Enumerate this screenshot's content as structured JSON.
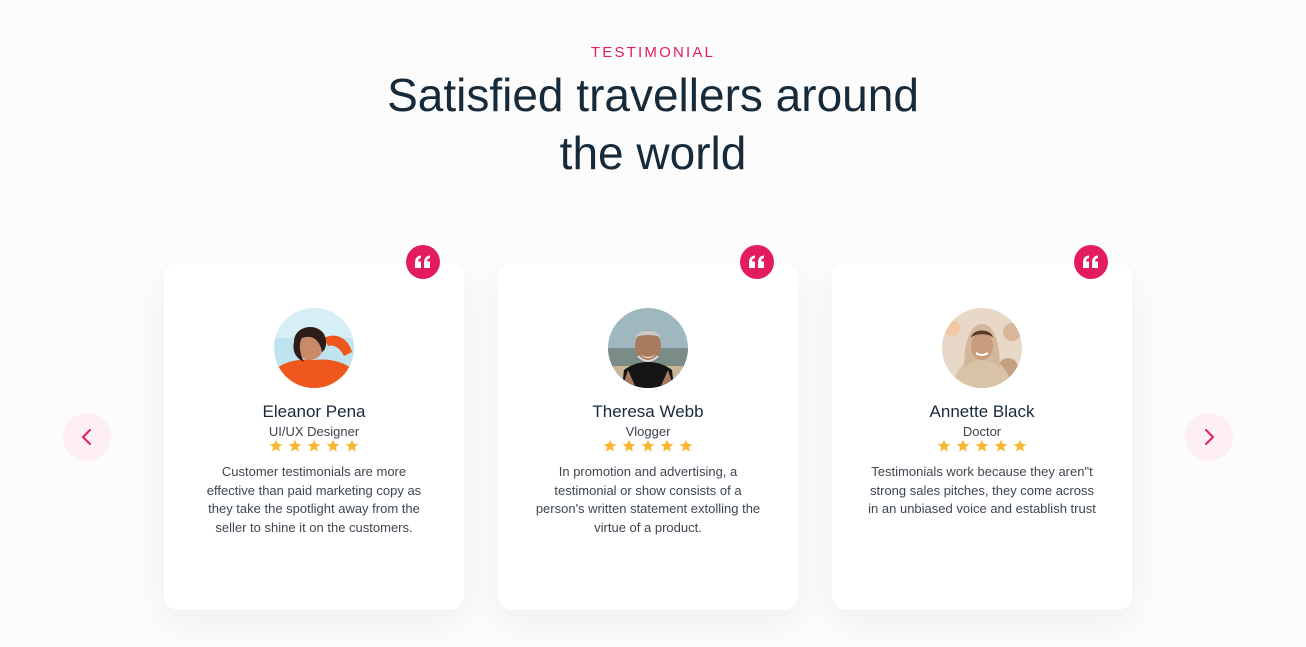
{
  "section": {
    "eyebrow": "TESTIMONIAL",
    "heading_line1": "Satisfied travellers around",
    "heading_line2": "the world"
  },
  "colors": {
    "accent": "#e31c5f",
    "heading": "#172a3a",
    "star": "#f7b731",
    "arrow_bg": "#fdeff3"
  },
  "navigation": {
    "prev_icon": "chevron-left-icon",
    "next_icon": "chevron-right-icon"
  },
  "testimonials": [
    {
      "name": "Eleanor Pena",
      "role": "UI/UX Designer",
      "rating": 5,
      "text": "Customer testimonials are more effective than paid marketing copy as they take the spotlight away from the seller to shine it on the customers.",
      "quote_icon": "quote-icon"
    },
    {
      "name": "Theresa Webb",
      "role": "Vlogger",
      "rating": 5,
      "text": "In promotion and advertising, a testimonial or show consists of a person's written statement extolling the virtue of a product.",
      "quote_icon": "quote-icon"
    },
    {
      "name": "Annette Black",
      "role": "Doctor",
      "rating": 5,
      "text": "Testimonials work because they aren\"t strong sales pitches, they come across in an unbiased voice and establish trust",
      "quote_icon": "quote-icon"
    }
  ]
}
